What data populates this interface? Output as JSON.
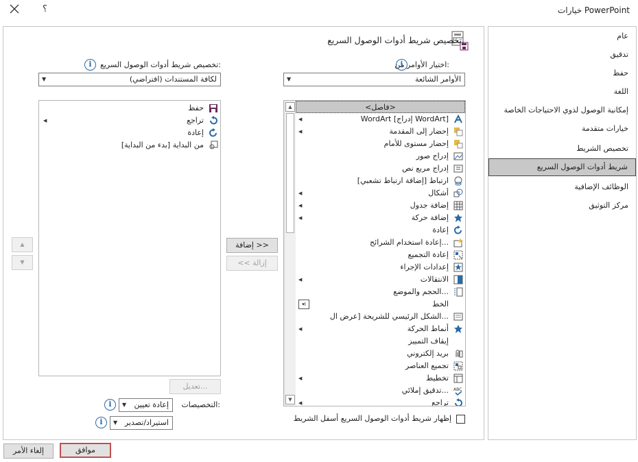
{
  "window": {
    "title": "خيارات PowerPoint",
    "help": "؟",
    "close": "✕"
  },
  "categories": [
    {
      "label": "عام",
      "selected": false
    },
    {
      "label": "تدقيق",
      "selected": false
    },
    {
      "label": "حفظ",
      "selected": false
    },
    {
      "label": "اللغة",
      "selected": false
    },
    {
      "label": "إمكانية الوصول لذوي الاحتياجات الخاصة",
      "selected": false
    },
    {
      "label": "خيارات متقدمة",
      "selected": false
    },
    {
      "label": "تخصيص الشريط",
      "selected": false
    },
    {
      "label": "شريط أدوات الوصول السريع",
      "selected": true
    },
    {
      "label": "الوظائف الإضافية",
      "selected": false
    },
    {
      "label": "مركز التوثيق",
      "selected": false
    }
  ],
  "header": {
    "title": "تخصيص شريط أدوات الوصول السريع."
  },
  "left_col": {
    "choose_label": "اختيار الأوامر من:",
    "choose_value": "الأوامر الشائعة",
    "commands": [
      {
        "label": "<فاصل>",
        "icon": "separator",
        "arrow": false,
        "selected": true
      },
      {
        "label": "WordArt [إدراج WordArt]",
        "icon": "wordart-icon",
        "arrow": true
      },
      {
        "label": "إحضار إلى المقدمة",
        "icon": "bring-front-icon",
        "arrow": true
      },
      {
        "label": "إحضار مستوى للأمام",
        "icon": "bring-forward-icon",
        "arrow": false
      },
      {
        "label": "إدراج صور",
        "icon": "insert-picture-icon",
        "arrow": false
      },
      {
        "label": "إدراج مربع نص",
        "icon": "text-box-icon",
        "arrow": false
      },
      {
        "label": "ارتباط [إضافة ارتباط تشعبي]",
        "icon": "link-icon",
        "arrow": false
      },
      {
        "label": "أشكال",
        "icon": "shapes-icon",
        "arrow": true
      },
      {
        "label": "إضافة جدول",
        "icon": "table-icon",
        "arrow": true
      },
      {
        "label": "إضافة حركة",
        "icon": "animation-icon",
        "arrow": true
      },
      {
        "label": "إعادة",
        "icon": "redo-icon",
        "arrow": false
      },
      {
        "label": "إعادة استخدام الشرائح...",
        "icon": "reuse-slides-icon",
        "arrow": false
      },
      {
        "label": "إعادة التجميع",
        "icon": "regroup-icon",
        "arrow": false
      },
      {
        "label": "إعدادات الإجراء",
        "icon": "action-icon",
        "arrow": false
      },
      {
        "label": "الانتقالات",
        "icon": "transitions-icon",
        "arrow": true
      },
      {
        "label": "الحجم والموضع...",
        "icon": "size-position-icon",
        "arrow": false
      },
      {
        "label": "الخط",
        "icon": "font-icon",
        "arrow": false,
        "combo": true
      },
      {
        "label": "الشكل الرئيسي للشريحة [عرض ال...",
        "icon": "slide-master-icon",
        "arrow": false
      },
      {
        "label": "أنماط الحركة",
        "icon": "animation-styles-icon",
        "arrow": true
      },
      {
        "label": "إيقاف التمييز",
        "icon": "none",
        "arrow": false
      },
      {
        "label": "بريد إلكتروني",
        "icon": "email-icon",
        "arrow": false
      },
      {
        "label": "تجميع العناصر",
        "icon": "group-icon",
        "arrow": false
      },
      {
        "label": "تخطيط",
        "icon": "layout-icon",
        "arrow": true
      },
      {
        "label": "تدقيق إملائي...",
        "icon": "spelling-icon",
        "arrow": false
      },
      {
        "label": "تراجع",
        "icon": "undo-icon",
        "arrow": true
      }
    ],
    "show_below_label": "إظهار شريط أدوات الوصول السريع أسفل الشريط"
  },
  "right_col": {
    "customize_label": "تخصيص شريط أدوات الوصول السريع:",
    "customize_value": "لكافة المستندات (افتراضي)",
    "items": [
      {
        "label": "حفظ",
        "icon": "save-icon",
        "arrow": false
      },
      {
        "label": "تراجع",
        "icon": "undo-icon",
        "arrow": true
      },
      {
        "label": "إعادة",
        "icon": "redo-icon",
        "arrow": false
      },
      {
        "label": "من البداية [بدء من البداية]",
        "icon": "from-beginning-icon",
        "arrow": false
      }
    ],
    "modify_button": "تعديل...",
    "customizations_label": "التخصيصات:",
    "reset_button": "إعادة تعيين",
    "import_export_button": "استيراد/تصدير"
  },
  "add_button": "إضافة >>",
  "remove_button": "<< إزالة",
  "ok_button": "موافق",
  "cancel_button": "إلغاء الأمر",
  "colors": {
    "accent": "#2a6aa5",
    "selected_bg": "#c8c8c8",
    "ok_border": "#c0504d"
  }
}
